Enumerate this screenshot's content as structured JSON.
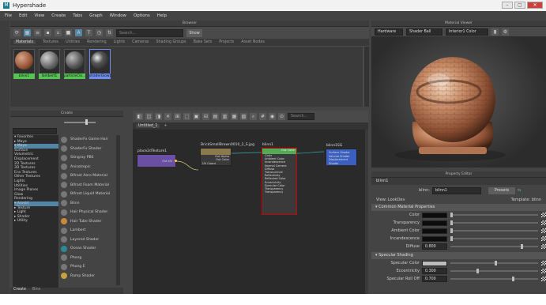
{
  "app": {
    "title": "Hypershade",
    "logo": "M"
  },
  "window_buttons": {
    "minimize": "–",
    "maximize": "▢",
    "close": "✕"
  },
  "menu": [
    "File",
    "Edit",
    "View",
    "Create",
    "Tabs",
    "Graph",
    "Window",
    "Options",
    "Help"
  ],
  "browser": {
    "title": "Browser",
    "search_placeholder": "Search...",
    "show_label": "Show",
    "tabs": [
      "Materials",
      "Textures",
      "Utilities",
      "Rendering",
      "Lights",
      "Cameras",
      "Shading Groups",
      "Bake Sets",
      "Projects",
      "Asset Nodes"
    ],
    "swatches": [
      {
        "label": "blinn1",
        "color": "#9b5a3a",
        "label_bg": "#55c455"
      },
      {
        "label": "lambert1",
        "color": "#6a6a6a",
        "label_bg": "#55c455"
      },
      {
        "label": "particleClo...",
        "color": "#555555",
        "label_bg": "#55c455"
      },
      {
        "label": "shaderGlow1",
        "color": "#3a3a3a",
        "label_bg": "#6f8ef0"
      }
    ]
  },
  "material_viewer": {
    "title": "Material Viewer",
    "renderer": "Hardware",
    "shape": "Shader Ball",
    "env": "Interior1 Color"
  },
  "create": {
    "title": "Create",
    "tree": [
      "▾ Favorites",
      "  ▸ Maya",
      "▾ Maya",
      "   Surface",
      "   Volumetric",
      "   Displacement",
      "   2D Textures",
      "   3D Textures",
      "   Env Textures",
      "   Other Textures",
      "   Lights",
      "   Utilities",
      "   Image Planes",
      "   Glow",
      "   Rendering",
      "▾ Arnold",
      "  ▸ Texture",
      "  ▸ Light",
      "  ▸ Shader",
      "  ▸ Utility"
    ],
    "nodes": [
      "ShaderFx Game Hair",
      "ShaderFx Shader",
      "Stingray PBS",
      "Anisotropic",
      "Bifrost Aero Material",
      "Bifrost Foam Material",
      "Bifrost Liquid Material",
      "Blinn",
      "Hair Physical Shader",
      "Hair Tube Shader",
      "Lambert",
      "Layered Shader",
      "Ocean Shader",
      "Phong",
      "Phong E",
      "Ramp Shader"
    ],
    "bottom_tabs": [
      "Create",
      "Bins"
    ]
  },
  "graph": {
    "tab_label": "Untitled_1",
    "search_placeholder": "Search...",
    "nodes": {
      "place2d": {
        "title": "place2dTexture1",
        "port": "Out UV",
        "color": "#6a4fa3"
      },
      "brick": {
        "title": "BrickSmallBrown0010_2_S.jpg",
        "ports_out": [
          "Out Alpha",
          "Out Color"
        ],
        "port_in": "UV Coord",
        "color": "#8a7a4a"
      },
      "blinn": {
        "title": "blinn1",
        "port_out": "Out Color",
        "attrs": [
          "Color",
          "Ambient Color",
          "Incandescence",
          "Normal Camera",
          "Diffuse",
          "Translucence",
          "Reflectivity",
          "Reflected Color",
          "Eccentricity",
          "Specular Color",
          "Transparency",
          "Transparency"
        ],
        "color": "#55aa55"
      },
      "sg": {
        "title": "blinn1SG",
        "ports": [
          "Surface Shader",
          "Volume Shader",
          "Displacement Shader"
        ],
        "color": "#3b5fc0"
      }
    }
  },
  "property_editor": {
    "title": "Property Editor",
    "tab": "blinn1",
    "type_label": "blinn:",
    "name_value": "blinn1",
    "presets_label": "Presets",
    "view_label": "View: LookDev",
    "template_label": "Template: blinn",
    "sections": {
      "common": {
        "title": "Common Material Properties",
        "rows": [
          {
            "label": "Color",
            "kind": "color"
          },
          {
            "label": "Transparency",
            "kind": "color"
          },
          {
            "label": "Ambient Color",
            "kind": "color"
          },
          {
            "label": "Incandescence",
            "kind": "color"
          },
          {
            "label": "Diffuse",
            "kind": "value",
            "value": "0.800"
          }
        ]
      },
      "specular": {
        "title": "Specular Shading",
        "rows": [
          {
            "label": "Specular Color",
            "kind": "colorlight"
          },
          {
            "label": "Eccentricity",
            "kind": "value",
            "value": "0.300"
          },
          {
            "label": "Specular Roll Off",
            "kind": "value",
            "value": "0.700"
          }
        ]
      }
    }
  }
}
